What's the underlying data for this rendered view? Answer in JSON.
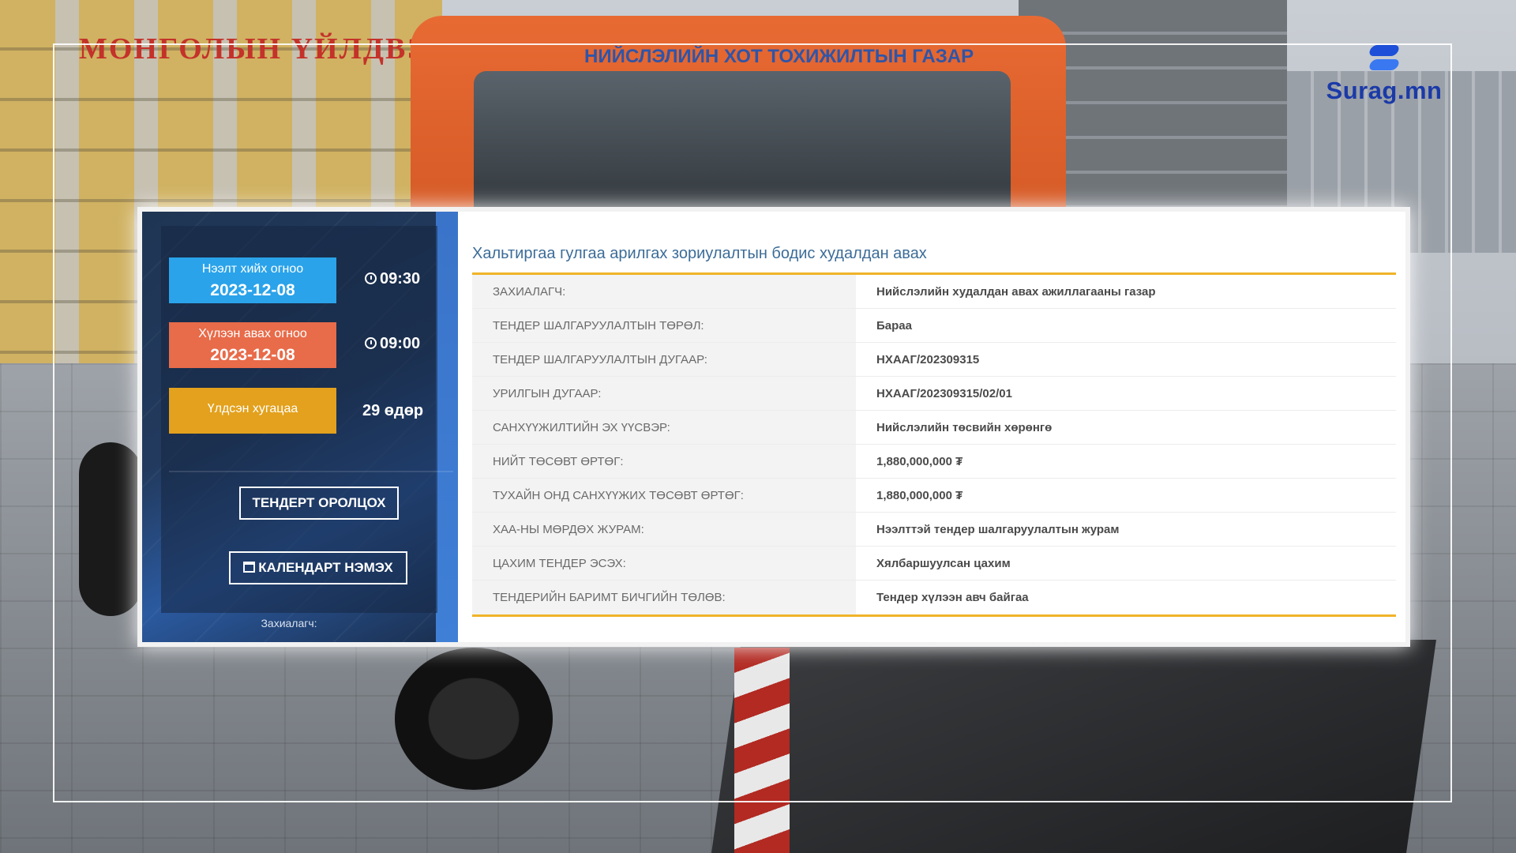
{
  "background": {
    "left_sign": "МОНГОЛЫН ҮЙЛДВЭРЧИН",
    "truck_banner": "НИЙСЛЭЛИЙН ХОТ ТОХИЖИЛТЫН ГАЗАР ОНБААТУГ"
  },
  "logo": {
    "text": "Surag.mn"
  },
  "sidebar": {
    "open_date": {
      "label": "Нээлт хийх огноо",
      "date": "2023-12-08",
      "time": "09:30",
      "color": "#2aa3ea"
    },
    "receive_date": {
      "label": "Хүлээн авах огноо",
      "date": "2023-12-08",
      "time": "09:00",
      "color": "#e86b4a"
    },
    "remaining": {
      "label": "Үлдсэн хугацаа",
      "value": "29 өдөр",
      "color": "#e3a11d"
    },
    "join_button": "ТЕНДЕРТ ОРОЛЦОХ",
    "calendar_button": "КАЛЕНДАРТ НЭМЭХ",
    "footer_label": "Захиалагч:"
  },
  "content": {
    "title": "Хальтиргаа гулгаа арилгах зориулалтын бодис худалдан авах",
    "rows": [
      {
        "key": "ЗАХИАЛАГЧ:",
        "value": "Нийслэлийн худалдан авах ажиллагааны газар"
      },
      {
        "key": "ТЕНДЕР ШАЛГАРУУЛАЛТЫН ТӨРӨЛ:",
        "value": "Бараа"
      },
      {
        "key": "ТЕНДЕР ШАЛГАРУУЛАЛТЫН ДУГААР:",
        "value": "НХААГ/202309315"
      },
      {
        "key": "УРИЛГЫН ДУГААР:",
        "value": "НХААГ/202309315/02/01"
      },
      {
        "key": "САНХҮҮЖИЛТИЙН ЭХ ҮҮСВЭР:",
        "value": "Нийслэлийн төсвийн хөрөнгө"
      },
      {
        "key": "НИЙТ ТӨСӨВТ ӨРТӨГ:",
        "value": "1,880,000,000 ₮"
      },
      {
        "key": "ТУХАЙН ОНД САНХҮҮЖИХ ТӨСӨВТ ӨРТӨГ:",
        "value": "1,880,000,000 ₮"
      },
      {
        "key": "ХАА-НЫ МӨРДӨХ ЖУРАМ:",
        "value": "Нээлттэй тендер шалгаруулалтын журам"
      },
      {
        "key": "ЦАХИМ ТЕНДЕР ЭСЭХ:",
        "value": "Хялбаршуулсан цахим"
      },
      {
        "key": "ТЕНДЕРИЙН БАРИМТ БИЧГИЙН ТӨЛӨВ:",
        "value": "Тендер хүлээн авч байгаа"
      }
    ]
  }
}
